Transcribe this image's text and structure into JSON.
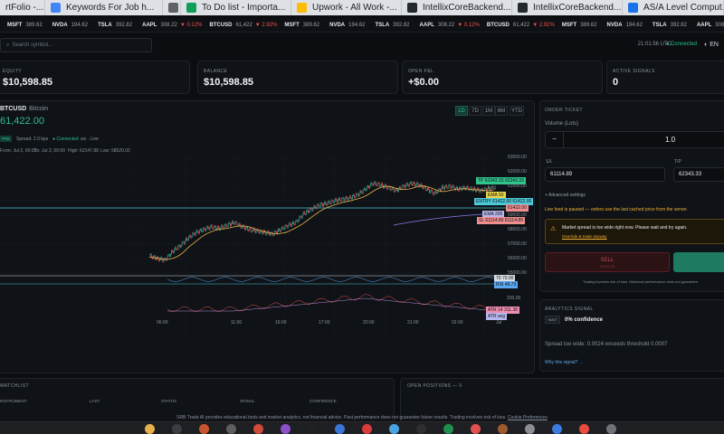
{
  "browser_tabs": [
    {
      "label": "rtFolio -...",
      "color": "#f2a32c"
    },
    {
      "label": "Keywords For Job h...",
      "color": "#4285f4"
    },
    {
      "label": "",
      "color": "#5f6368"
    },
    {
      "label": "To Do list - Importa...",
      "color": "#0f9d58"
    },
    {
      "label": "Upwork - All Work -...",
      "color": "#fbbc04"
    },
    {
      "label": "IntellixCoreBackend...",
      "color": "#24292f"
    },
    {
      "label": "IntellixCoreBackend...",
      "color": "#24292f"
    },
    {
      "label": "AS/A Level Comput...",
      "color": "#1a73e8"
    }
  ],
  "ticker": [
    {
      "sym": "MSFT",
      "price": "389.62",
      "chg": ""
    },
    {
      "sym": "NVDA",
      "price": "194.62",
      "chg": ""
    },
    {
      "sym": "TSLA",
      "price": "392.82",
      "chg": ""
    },
    {
      "sym": "AAPL",
      "price": "308.22",
      "chg": "▼ 0.12%"
    },
    {
      "sym": "BTCUSD",
      "price": "61,422",
      "chg": "▼ 2.92%"
    },
    {
      "sym": "MSFT",
      "price": "389.62",
      "chg": ""
    },
    {
      "sym": "NVDA",
      "price": "194.62",
      "chg": ""
    },
    {
      "sym": "TSLA",
      "price": "392.82",
      "chg": ""
    },
    {
      "sym": "AAPL",
      "price": "308.22",
      "chg": "▼ 0.12%"
    },
    {
      "sym": "BTCUSD",
      "price": "61,422",
      "chg": "▼ 2.92%"
    },
    {
      "sym": "MSFT",
      "price": "389.62",
      "chg": ""
    },
    {
      "sym": "NVDA",
      "price": "194.62",
      "chg": ""
    },
    {
      "sym": "TSLA",
      "price": "392.82",
      "chg": ""
    },
    {
      "sym": "AAPL",
      "price": "308.22",
      "chg": "▼ 0.12%"
    }
  ],
  "topbar": {
    "search_placeholder": "Search symbol...",
    "clock": "21:01:56 UTC",
    "connection": "● Connected",
    "lang": "EN"
  },
  "stats": [
    {
      "label": "EQUITY",
      "value": "$10,598.85"
    },
    {
      "label": "BALANCE",
      "value": "$10,598.85"
    },
    {
      "label": "OPEN P&L",
      "value": "+$0.00"
    },
    {
      "label": "ACTIVE SIGNALS",
      "value": "0"
    }
  ],
  "chart_header": {
    "symbol": "BTCUSD",
    "name": "Bitcoin",
    "price": "61,422.00",
    "timeframes": [
      "1D",
      "7D",
      "1M",
      "6M",
      "YTD"
    ],
    "active_timeframe": "1D",
    "badge": "PRE",
    "spread": "Spread: 2.0 bps",
    "connected": "● Connected",
    "live": "ws · Live",
    "range_from": "From: Jul 2, 00:05",
    "range_to": "To: Jul 3, 00:00",
    "high": "High: 62147.88",
    "low": "Low: 58520.02"
  },
  "chart_data": {
    "type": "candlestick",
    "y_ticks": [
      "63000.00",
      "62000.00",
      "61000.00",
      "60000.00",
      "59000.00",
      "58000.00",
      "57000.00",
      "56000.00",
      "55000.00"
    ],
    "x_ticks": [
      "06:00",
      "11:00",
      "16:00",
      "17:00",
      "20:00",
      "21:00",
      "02:00",
      "Jul"
    ],
    "close_path": [
      56700,
      56500,
      56400,
      57000,
      57400,
      57900,
      58300,
      58500,
      58700,
      58600,
      58800,
      59000,
      58700,
      58500,
      58400,
      58300,
      58200,
      58500,
      58800,
      59000,
      59600,
      59900,
      60200,
      60300,
      60500,
      60600,
      60700,
      60900,
      61300,
      61700,
      61600,
      61400,
      61200,
      61500,
      61700,
      61600,
      61300,
      61000,
      61400,
      61500,
      61300,
      61400,
      61300,
      61200,
      61350,
      61422
    ],
    "price_lines": [
      {
        "label": "TP 62343.33",
        "value": "62343.33",
        "color": "#31c48d"
      },
      {
        "label": "EMA 50",
        "value": "",
        "color": "#e9d44c"
      },
      {
        "label": "ENTRY 61422.00",
        "value": "61422.00",
        "color": "#4cc9d8"
      },
      {
        "label": "",
        "value": "61422.00",
        "color": "#ef8f8f"
      },
      {
        "label": "EMA 200",
        "value": "",
        "color": "#b9b7f0"
      },
      {
        "label": "SL 61114.89",
        "value": "61114.89",
        "color": "#ef8f8f"
      }
    ],
    "indicators": [
      {
        "label": "70",
        "value": "70.00"
      },
      {
        "label": "RSI",
        "value": "48.73"
      },
      {
        "label": "ATR 14",
        "value": "311.38"
      },
      {
        "label": "ATR avg",
        "value": ""
      }
    ],
    "sub_axis": [
      "200.00"
    ]
  },
  "order_ticket": {
    "title": "ORDER TICKET",
    "volume_label": "Volume (Lots)",
    "volume": "1.0",
    "sl_label": "S/L",
    "sl": "61114.89",
    "tp_label": "T/P",
    "tp": "62343.33",
    "advanced": "+ Advanced settings",
    "feed_paused": "Live feed is paused — orders use the last cached price from the server.",
    "warn_title": "Market spread is too wide right now. Please wait and try again.",
    "warn_link": "Override & trade anyway",
    "sell_label": "SELL",
    "sell_sub": "61421.00",
    "risk": "Trading involves risk of loss. Historical performance does not guarantee."
  },
  "analytics": {
    "title": "ANALYTICS SIGNAL",
    "badge": "WAIT",
    "confidence": "0% confidence",
    "reason": "Spread too wide: 0.0024 exceeds threshold 0.0007",
    "why": "Why this signal? →"
  },
  "watchlist": {
    "title": "WATCHLIST",
    "cols": [
      "INSTRUMENT",
      "LAST",
      "STATUS",
      "SIGNAL",
      "CONFIDENCE"
    ]
  },
  "positions": {
    "title": "OPEN POSITIONS — 0"
  },
  "footer": {
    "text": "SRB Trade AI provides educational tools and market analytics, not financial advice. Past performance does not guarantee future results. Trading involves risk of loss.",
    "link": "Cookie Preferences"
  }
}
